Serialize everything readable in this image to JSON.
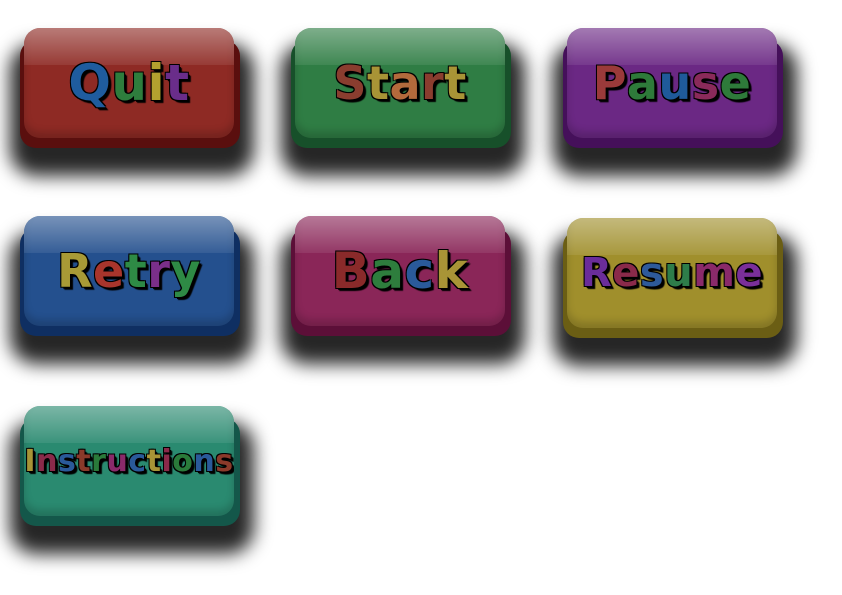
{
  "buttons": [
    {
      "id": "quit",
      "label": "Quit",
      "base": "#8e2a24",
      "rim": "#5a0f0e",
      "letters": [
        "#1f5c9e",
        "#2e7d3d",
        "#b3a12f",
        "#6a2d8a"
      ],
      "fontSize": 50
    },
    {
      "id": "start",
      "label": "Start",
      "base": "#2f7d44",
      "rim": "#17502a",
      "letters": [
        "#8a3d2f",
        "#a89436",
        "#b36a3c",
        "#8a3d2f",
        "#a89436"
      ],
      "fontSize": 46
    },
    {
      "id": "pause",
      "label": "Pause",
      "base": "#6b2884",
      "rim": "#45105a",
      "letters": [
        "#9a3a3a",
        "#2e7a3a",
        "#1f5a9a",
        "#8a2a5a",
        "#2e7a3a"
      ],
      "fontSize": 46
    },
    {
      "id": "retry",
      "label": "Retry",
      "base": "#24508e",
      "rim": "#0f2f62",
      "letters": [
        "#a89a36",
        "#a8352c",
        "#2e8a45",
        "#7a2f8a",
        "#2e8a45"
      ],
      "fontSize": 46
    },
    {
      "id": "back",
      "label": "Back",
      "base": "#8a2658",
      "rim": "#5c0f38",
      "letters": [
        "#8a2a2a",
        "#2e7d3d",
        "#2a5a9a",
        "#a89436"
      ],
      "fontSize": 50
    },
    {
      "id": "resume",
      "label": "Resume",
      "base": "#a08f2c",
      "rim": "#6b5e14",
      "letters": [
        "#6a2d9a",
        "#8a2a4a",
        "#2e5a9a",
        "#2e7d4a",
        "#8a2a6a",
        "#7a2f9a"
      ],
      "fontSize": 40
    },
    {
      "id": "instructions",
      "label": "Instructions",
      "base": "#2a8a70",
      "rim": "#14574a",
      "letters": [
        "#a89436",
        "#8a2a4a",
        "#2a5a9a",
        "#8a3a2a",
        "#2a7a3a",
        "#8a2a6a",
        "#2a5a9a",
        "#a89436",
        "#8a2a4a",
        "#2a7a3a",
        "#2a5a9a",
        "#8a3a2a"
      ],
      "fontSize": 30
    }
  ]
}
